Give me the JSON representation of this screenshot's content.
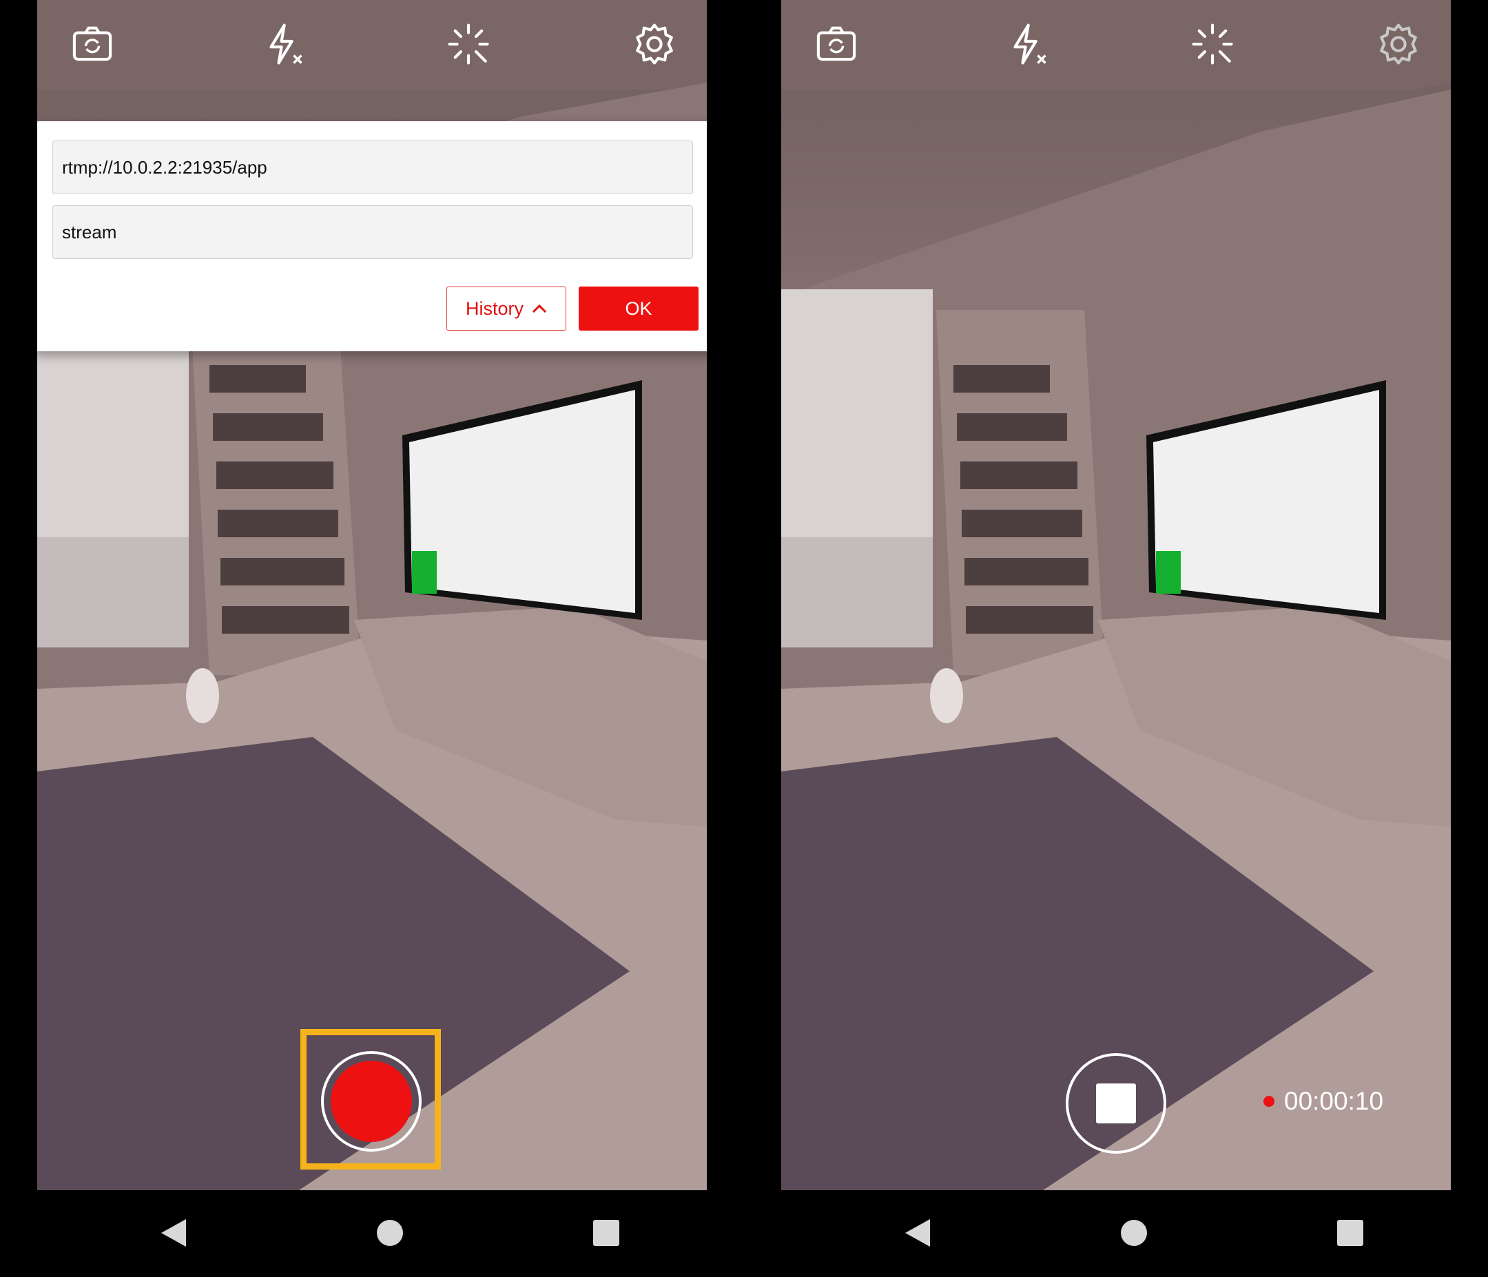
{
  "left_screen": {
    "topbar": {
      "icons": [
        "switch-camera-icon",
        "flash-off-icon",
        "effects-icon",
        "settings-icon"
      ]
    },
    "dialog": {
      "url_value": "rtmp://10.0.2.2:21935/app",
      "stream_value": "stream",
      "history_label": "History",
      "ok_label": "OK"
    },
    "record_button": {
      "state": "idle",
      "highlighted": true
    }
  },
  "right_screen": {
    "topbar": {
      "icons": [
        "switch-camera-icon",
        "flash-off-icon",
        "effects-icon",
        "settings-icon"
      ]
    },
    "stop_button": {
      "state": "recording"
    },
    "timer": "00:00:10"
  },
  "navbar": {
    "icons": [
      "back-icon",
      "home-icon",
      "recents-icon"
    ]
  },
  "colors": {
    "accent": "#ee1111",
    "highlight": "#f6b21a",
    "dialog_bg": "#ffffff",
    "field_bg": "#f3f3f3"
  }
}
